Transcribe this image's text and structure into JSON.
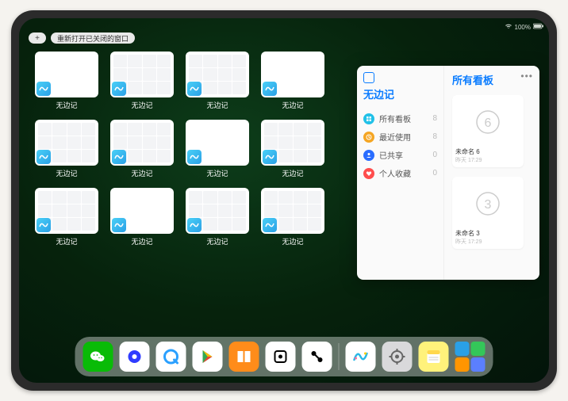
{
  "status": {
    "time": "",
    "wifi": "wifi-icon",
    "battery_pct": "100%"
  },
  "controls": {
    "add_label": "+",
    "reopen_label": "重新打开已关闭的窗口"
  },
  "app_name": "无边记",
  "window_thumbs": [
    {
      "label": "无边记",
      "style": "plain"
    },
    {
      "label": "无边记",
      "style": "cal"
    },
    {
      "label": "无边记",
      "style": "cal"
    },
    {
      "label": "无边记",
      "style": "plain"
    },
    {
      "label": "无边记",
      "style": "cal"
    },
    {
      "label": "无边记",
      "style": "cal"
    },
    {
      "label": "无边记",
      "style": "plain"
    },
    {
      "label": "无边记",
      "style": "cal"
    },
    {
      "label": "无边记",
      "style": "cal"
    },
    {
      "label": "无边记",
      "style": "plain"
    },
    {
      "label": "无边记",
      "style": "cal"
    },
    {
      "label": "无边记",
      "style": "cal"
    }
  ],
  "sidebar": {
    "title": "无边记",
    "items": [
      {
        "icon": "square-grid-icon",
        "color": "#21c1e8",
        "label": "所有看板",
        "count": 8
      },
      {
        "icon": "clock-icon",
        "color": "#f5a623",
        "label": "最近使用",
        "count": 8
      },
      {
        "icon": "person-icon",
        "color": "#2a6dff",
        "label": "已共享",
        "count": 0
      },
      {
        "icon": "heart-icon",
        "color": "#ff4d4d",
        "label": "个人收藏",
        "count": 0
      }
    ]
  },
  "main_panel": {
    "title": "所有看板",
    "boards": [
      {
        "name": "未命名 6",
        "digit": "6",
        "time": "昨天 17:29"
      },
      {
        "name": "未命名 3",
        "digit": "3",
        "time": "昨天 17:29"
      }
    ]
  },
  "dock": [
    {
      "name": "wechat",
      "bg": "#09bb07"
    },
    {
      "name": "quark-a",
      "bg": "#ffffff"
    },
    {
      "name": "quark-b",
      "bg": "#ffffff"
    },
    {
      "name": "play",
      "bg": "#ffffff"
    },
    {
      "name": "books",
      "bg": "#ff8c1a"
    },
    {
      "name": "dice",
      "bg": "#ffffff"
    },
    {
      "name": "connect",
      "bg": "#ffffff"
    },
    {
      "name": "freeform",
      "bg": "#ffffff"
    },
    {
      "name": "settings",
      "bg": "#d9d9db"
    },
    {
      "name": "notes",
      "bg": "#fff27b"
    }
  ],
  "dock_recent_quad": [
    "#2aa0e6",
    "#34c759",
    "#ff9500",
    "#5b7fff"
  ]
}
